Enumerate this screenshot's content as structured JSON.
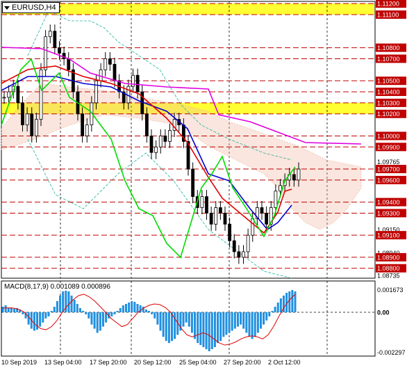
{
  "chart_title": {
    "symbol_timeframe": "EURUSD,H4"
  },
  "macd": {
    "label": "MACD(8,17,9) 0.001089 0.000896",
    "y_labels": [
      "0.001673",
      "0.00",
      "-0.002297"
    ],
    "hist": [
      0.4,
      0.5,
      0.3,
      0.35,
      0.25,
      0.3,
      0.2,
      -0.1,
      -0.3,
      -0.6,
      -0.8,
      -0.9,
      -0.85,
      -0.7,
      -0.5,
      -0.3,
      -0.2,
      0.1,
      0.4,
      0.8,
      1.2,
      1.5,
      1.6,
      1.5,
      1.2,
      0.9,
      0.6,
      0.3,
      0.1,
      -0.1,
      -0.3,
      -0.6,
      -0.8,
      -1.0,
      -0.9,
      -0.7,
      -0.5,
      -0.3,
      -0.2,
      -0.1,
      0.1,
      0.3,
      0.5,
      0.6,
      0.7,
      0.8,
      0.75,
      0.6,
      0.5,
      0.4,
      0.2,
      0.1,
      -0.1,
      -0.3,
      -0.6,
      -0.9,
      -1.2,
      -1.4,
      -1.5,
      -1.4,
      -1.3,
      -1.1,
      -0.9,
      -0.7,
      -0.5,
      -0.7,
      -1.0,
      -1.3,
      -1.5,
      -1.6,
      -1.7,
      -1.8,
      -1.9,
      -1.8,
      -1.7,
      -1.5,
      -1.4,
      -1.2,
      -1.1,
      -1.0,
      -0.9,
      -0.8,
      -0.7,
      -0.6,
      -0.8,
      -1.0,
      -1.2,
      -1.3,
      -1.2,
      -1.0,
      -0.8,
      -0.6,
      -0.4,
      -0.2,
      0.1,
      0.4,
      0.7,
      1.0,
      1.2,
      1.4,
      1.5,
      1.6,
      1.5
    ],
    "signal": [
      0.3,
      0.32,
      0.3,
      0.2,
      0.0,
      -0.3,
      -0.6,
      -0.8,
      -0.85,
      -0.7,
      -0.4,
      0.0,
      0.5,
      0.9,
      1.2,
      1.3,
      1.1,
      0.8,
      0.4,
      0.0,
      -0.3,
      -0.5,
      -0.7,
      -0.6,
      -0.3,
      0.0,
      0.3,
      0.5,
      0.6,
      0.55,
      0.35,
      0.0,
      -0.4,
      -0.8,
      -1.1,
      -1.2,
      -1.1,
      -1.0,
      -1.1,
      -1.3,
      -1.5,
      -1.6,
      -1.55,
      -1.45,
      -1.3,
      -1.2,
      -1.15,
      -1.2,
      -1.3,
      -1.1,
      -0.7,
      -0.2,
      0.4,
      0.9,
      1.3
    ]
  },
  "x_axis": {
    "labels": [
      "10 Sep 2019",
      "13 Sep 04:00",
      "17 Sep 20:00",
      "20 Sep 12:00",
      "25 Sep 04:00",
      "27 Sep 20:00",
      "2 Oct 12:00"
    ]
  },
  "price_axis": {
    "levels": [
      {
        "price": "1.11200",
        "kind": "hl"
      },
      {
        "price": "1.11100",
        "kind": "hl"
      },
      {
        "price": "1.10800",
        "kind": "hl"
      },
      {
        "price": "1.10700",
        "kind": "hl"
      },
      {
        "price": "1.10500",
        "kind": "hl"
      },
      {
        "price": "1.10400",
        "kind": "hl"
      },
      {
        "price": "1.10300",
        "kind": "hl"
      },
      {
        "price": "1.10200",
        "kind": "hl"
      },
      {
        "price": "1.10000",
        "kind": "hl"
      },
      {
        "price": "1.09900",
        "kind": "hl"
      },
      {
        "price": "1.09765",
        "kind": "plain"
      },
      {
        "price": "1.09700",
        "kind": "hl"
      },
      {
        "price": "1.09600",
        "kind": "hl"
      },
      {
        "price": "1.09400",
        "kind": "hl"
      },
      {
        "price": "1.09300",
        "kind": "hl"
      },
      {
        "price": "1.09150",
        "kind": "plain"
      },
      {
        "price": "1.09100",
        "kind": "hl"
      },
      {
        "price": "1.08940",
        "kind": "plain"
      },
      {
        "price": "1.08900",
        "kind": "hl"
      },
      {
        "price": "1.08800",
        "kind": "hl"
      },
      {
        "price": "1.08735",
        "kind": "plain"
      }
    ]
  },
  "colors": {
    "level_line": "#c00000",
    "zone": "#ffff33",
    "ma_blue": "#0000d0",
    "ma_red": "#e00000",
    "ma_magenta": "#e000e0",
    "ichimoku": "#00dd00",
    "candle": "#000000",
    "cloud": "#f0b8a0",
    "macd_hist": "#2090e0",
    "macd_signal": "#e00000"
  }
}
